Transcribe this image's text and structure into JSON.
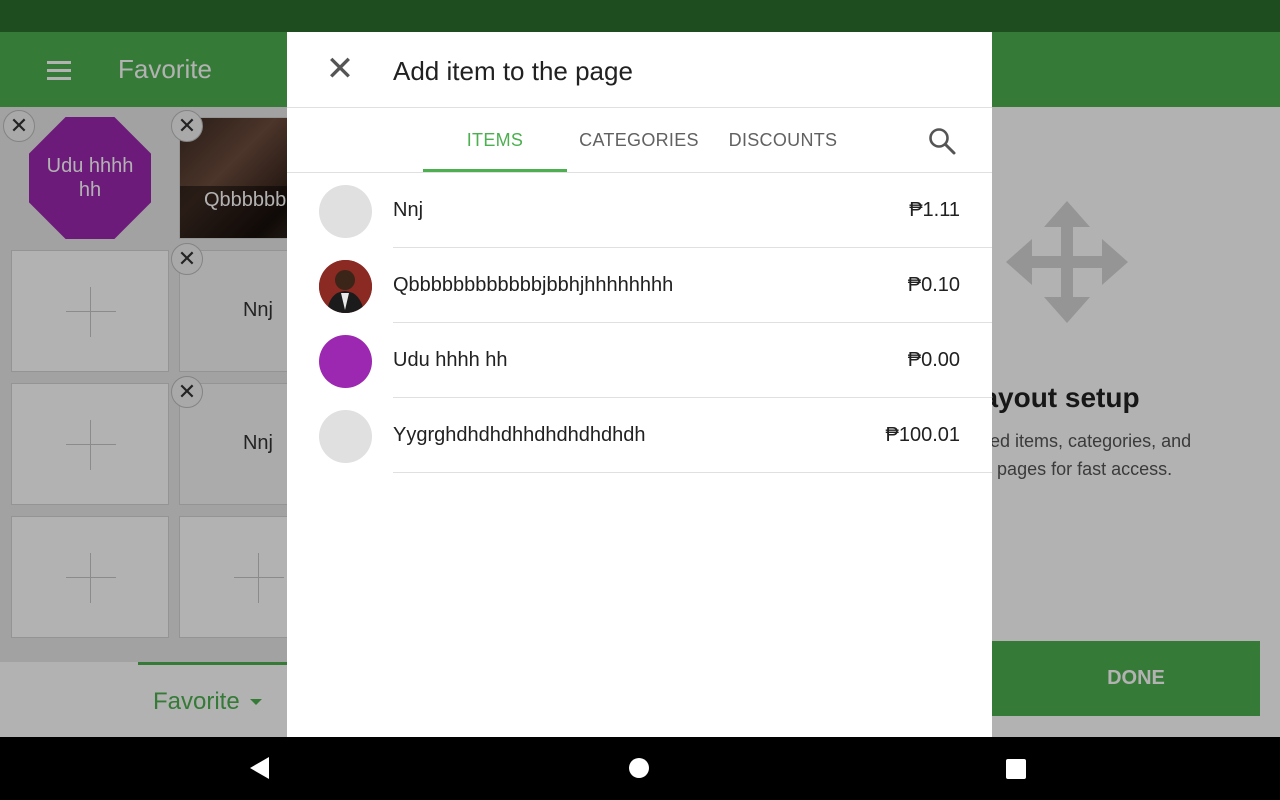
{
  "background": {
    "toolbar_title": "Favorite",
    "grid": {
      "tiles": [
        {
          "type": "octagon",
          "label": "Udu hhhh hh",
          "color": "#9c27b0"
        },
        {
          "type": "image",
          "label": "Qbbbbbbbbbbbjbbh"
        },
        {
          "type": "empty"
        },
        {
          "type": "text",
          "label": "Nnj"
        },
        {
          "type": "empty"
        },
        {
          "type": "text",
          "label": "Nnj"
        },
        {
          "type": "empty"
        },
        {
          "type": "empty"
        }
      ]
    },
    "page_tab_label": "Favorite",
    "setup": {
      "title": "m layout setup",
      "description": "ost used items, categories, and\non the pages for fast access.",
      "done_label": "DONE"
    }
  },
  "dialog": {
    "title": "Add item to the page",
    "tabs": [
      {
        "label": "ITEMS",
        "active": true
      },
      {
        "label": "CATEGORIES",
        "active": false
      },
      {
        "label": "DISCOUNTS",
        "active": false
      }
    ],
    "items": [
      {
        "name": "Nnj",
        "price": "₱1.11",
        "avatar": "grey"
      },
      {
        "name": "Qbbbbbbbbbbbbjbbhjhhhhhhhh",
        "price": "₱0.10",
        "avatar": "photo"
      },
      {
        "name": "Udu hhhh hh",
        "price": "₱0.00",
        "avatar": "purple"
      },
      {
        "name": "Yygrghdhdhdhhdhdhdhdhdh",
        "price": "₱100.01",
        "avatar": "grey"
      }
    ]
  },
  "colors": {
    "accent": "#4caf50",
    "status_bar": "#1e4d1f",
    "purple": "#9c27b0",
    "avatar_grey": "#e0e0e0"
  },
  "icons": {
    "close": "close-icon",
    "search": "search-icon",
    "menu": "menu-icon",
    "move": "move-icon"
  }
}
